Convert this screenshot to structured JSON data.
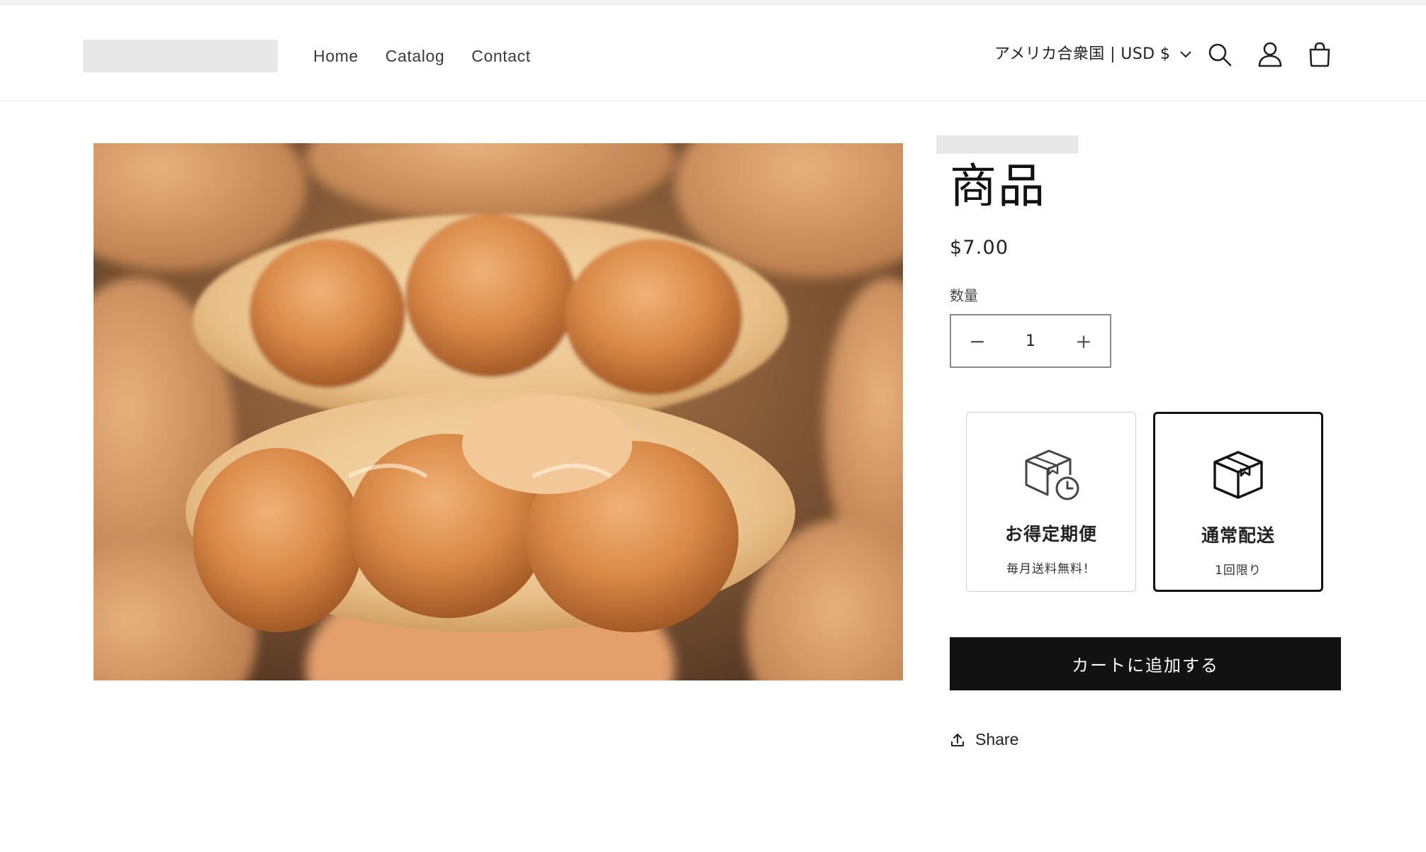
{
  "header": {
    "nav": [
      "Home",
      "Catalog",
      "Contact"
    ],
    "locale_label": "アメリカ合衆国 | USD $",
    "icons": [
      "search-icon",
      "account-icon",
      "cart-icon"
    ]
  },
  "product": {
    "title": "商品",
    "price": "$7.00",
    "quantity_label": "数量",
    "quantity_value": "1",
    "decrease_symbol": "−",
    "increase_symbol": "+",
    "plans": [
      {
        "title": "お得定期便",
        "subtitle": "毎月送料無料！",
        "selected": false
      },
      {
        "title": "通常配送",
        "subtitle": "1回限り",
        "selected": true
      }
    ],
    "add_to_cart": "カートに追加する",
    "share_label": "Share"
  },
  "colors": {
    "accent": "#121212",
    "border": "#8a8a8a",
    "placeholder": "#e8e8e8"
  }
}
